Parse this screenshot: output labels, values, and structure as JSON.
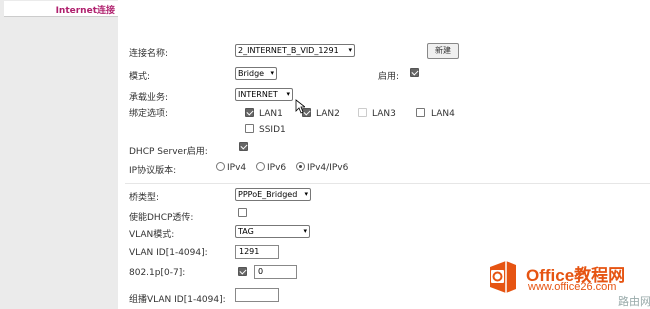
{
  "sidebar": {
    "active_item": "Internet连接"
  },
  "form": {
    "conn_name_label": "连接名称:",
    "conn_name_value": "2_INTERNET_B_VID_1291",
    "new_button": "新建",
    "mode_label": "模式:",
    "mode_value": "Bridge",
    "enable_label": "启用:",
    "service_label": "承载业务:",
    "service_value": "INTERNET",
    "bind_label": "绑定选项:",
    "ports": [
      {
        "label": "LAN1",
        "checked": true
      },
      {
        "label": "LAN2",
        "checked": true
      },
      {
        "label": "LAN3",
        "checked": false
      },
      {
        "label": "LAN4",
        "checked": false
      },
      {
        "label": "SSID1",
        "checked": false
      }
    ],
    "dhcp_server_label": "DHCP Server启用:",
    "ip_version_label": "IP协议版本:",
    "ip_options": [
      "IPv4",
      "IPv6",
      "IPv4/IPv6"
    ],
    "ip_selected": "IPv4/IPv6",
    "bridge_type_label": "桥类型:",
    "bridge_type_value": "PPPoE_Bridged",
    "dhcp_passthrough_label": "使能DHCP透传:",
    "vlan_mode_label": "VLAN模式:",
    "vlan_mode_value": "TAG",
    "vlan_id_label": "VLAN ID[1-4094]:",
    "vlan_id_value": "1291",
    "priority_label": "802.1p[0-7]:",
    "priority_value": "0",
    "multicast_vlan_label": "组播VLAN ID[1-4094]:",
    "multicast_vlan_value": ""
  },
  "watermark": {
    "title": "Office教程网",
    "url": "www.office26.com",
    "site": "路由网"
  },
  "colors": {
    "sidebar_accent": "#b0216e",
    "watermark": "#e65412"
  }
}
